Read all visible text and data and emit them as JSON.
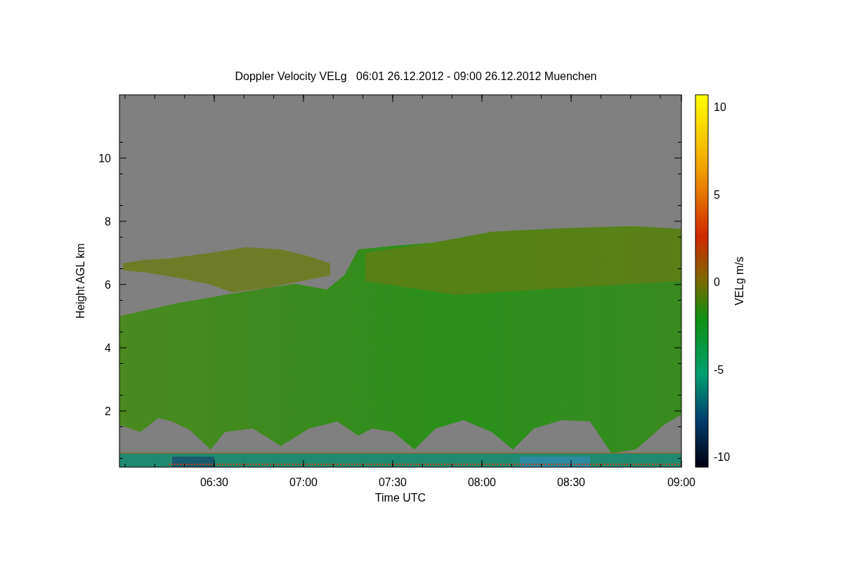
{
  "title": "Doppler Velocity VELg   06:01 26.12.2012 - 09:00 26.12.2012 Muenchen",
  "y_axis": {
    "label": "Height AGL km",
    "ticks": [
      "10",
      "8",
      "6",
      "4",
      "2"
    ]
  },
  "x_axis": {
    "label": "Time UTC",
    "ticks": [
      "06:30",
      "07:00",
      "07:30",
      "08:00",
      "08:30",
      "09:00"
    ]
  },
  "colorbar": {
    "label": "VELg m/s",
    "ticks": [
      "10",
      "5",
      "0",
      "-5",
      "-10"
    ]
  }
}
